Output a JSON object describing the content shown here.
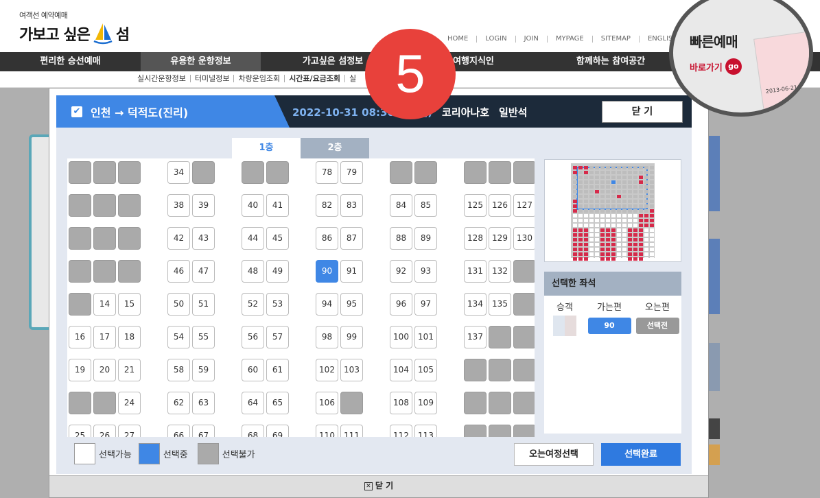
{
  "logo": {
    "small": "여객선 예약예매",
    "big_a": "가보고 싶은",
    "big_b": "섬"
  },
  "util_nav": [
    "HOME",
    "LOGIN",
    "JOIN",
    "MYPAGE",
    "SITEMAP",
    "ENGLISH"
  ],
  "gnb": [
    "편리한 승선예매",
    "유용한 운항정보",
    "가고싶은 섬정보",
    "여행지식인",
    "함께하는 참여공간"
  ],
  "lnb": [
    "실시간운항정보",
    "터미널정보",
    "차량운임조회",
    "시간표/요금조회",
    "실"
  ],
  "quick": {
    "title": "빠른예매",
    "link": "바로가기",
    "go": "go",
    "ticket_date": "2013-06-21"
  },
  "step_badge": "5",
  "modal": {
    "route": "인천 → 덕적도(진리)",
    "datetime": "2022-10-31 08:30(가는편)",
    "ship": "코리아나호",
    "grade": "일반석",
    "close": "닫 기",
    "tabs": [
      "1층",
      "2층"
    ],
    "selected_title": "선택한 좌석",
    "col_passenger": "승객",
    "col_outbound": "가는편",
    "col_return": "오는편",
    "outbound_seat": "90",
    "return_seat": "선택전",
    "legend": {
      "available": "선택가능",
      "selecting": "선택중",
      "unavailable": "선택불가"
    },
    "return_button": "오는여정선택",
    "complete_button": "선택완료",
    "bottom_close": "닫 기"
  },
  "colors": {
    "accent": "#3f87e5",
    "header_dark": "#1c2a3a",
    "unavailable": "#aaaaaa",
    "badge": "#e8413b"
  },
  "seat_rows": [
    [
      [
        "",
        0
      ],
      [
        "",
        0
      ],
      [
        "",
        0
      ],
      null,
      [
        "34",
        1
      ],
      [
        "",
        0
      ],
      null,
      [
        "",
        0
      ],
      [
        "",
        0
      ],
      null,
      [
        "78",
        1
      ],
      [
        "79",
        1
      ],
      null,
      [
        "",
        0
      ],
      [
        "",
        0
      ],
      null,
      [
        "",
        0
      ],
      [
        "",
        0
      ],
      [
        "",
        0
      ]
    ],
    [
      [
        "",
        0
      ],
      [
        "",
        0
      ],
      [
        "",
        0
      ],
      null,
      [
        "38",
        1
      ],
      [
        "39",
        1
      ],
      null,
      [
        "40",
        1
      ],
      [
        "41",
        1
      ],
      null,
      [
        "82",
        1
      ],
      [
        "83",
        1
      ],
      null,
      [
        "84",
        1
      ],
      [
        "85",
        1
      ],
      null,
      [
        "125",
        1
      ],
      [
        "126",
        1
      ],
      [
        "127",
        1
      ]
    ],
    [
      [
        "",
        0
      ],
      [
        "",
        0
      ],
      [
        "",
        0
      ],
      null,
      [
        "42",
        1
      ],
      [
        "43",
        1
      ],
      null,
      [
        "44",
        1
      ],
      [
        "45",
        1
      ],
      null,
      [
        "86",
        1
      ],
      [
        "87",
        1
      ],
      null,
      [
        "88",
        1
      ],
      [
        "89",
        1
      ],
      null,
      [
        "128",
        1
      ],
      [
        "129",
        1
      ],
      [
        "130",
        1
      ]
    ],
    [
      [
        "",
        0
      ],
      [
        "",
        0
      ],
      [
        "",
        0
      ],
      null,
      [
        "46",
        1
      ],
      [
        "47",
        1
      ],
      null,
      [
        "48",
        1
      ],
      [
        "49",
        1
      ],
      null,
      [
        "90",
        2
      ],
      [
        "91",
        1
      ],
      null,
      [
        "92",
        1
      ],
      [
        "93",
        1
      ],
      null,
      [
        "131",
        1
      ],
      [
        "132",
        1
      ],
      [
        "",
        0
      ]
    ],
    [
      [
        "",
        0
      ],
      [
        "14",
        1
      ],
      [
        "15",
        1
      ],
      null,
      [
        "50",
        1
      ],
      [
        "51",
        1
      ],
      null,
      [
        "52",
        1
      ],
      [
        "53",
        1
      ],
      null,
      [
        "94",
        1
      ],
      [
        "95",
        1
      ],
      null,
      [
        "96",
        1
      ],
      [
        "97",
        1
      ],
      null,
      [
        "134",
        1
      ],
      [
        "135",
        1
      ],
      [
        "",
        0
      ]
    ],
    [
      [
        "16",
        1
      ],
      [
        "17",
        1
      ],
      [
        "18",
        1
      ],
      null,
      [
        "54",
        1
      ],
      [
        "55",
        1
      ],
      null,
      [
        "56",
        1
      ],
      [
        "57",
        1
      ],
      null,
      [
        "98",
        1
      ],
      [
        "99",
        1
      ],
      null,
      [
        "100",
        1
      ],
      [
        "101",
        1
      ],
      null,
      [
        "137",
        1
      ],
      [
        "",
        0
      ],
      [
        "",
        0
      ]
    ],
    [
      [
        "19",
        1
      ],
      [
        "20",
        1
      ],
      [
        "21",
        1
      ],
      null,
      [
        "58",
        1
      ],
      [
        "59",
        1
      ],
      null,
      [
        "60",
        1
      ],
      [
        "61",
        1
      ],
      null,
      [
        "102",
        1
      ],
      [
        "103",
        1
      ],
      null,
      [
        "104",
        1
      ],
      [
        "105",
        1
      ],
      null,
      [
        "",
        0
      ],
      [
        "",
        0
      ],
      [
        "",
        0
      ]
    ],
    [
      [
        "",
        0
      ],
      [
        "",
        0
      ],
      [
        "24",
        1
      ],
      null,
      [
        "62",
        1
      ],
      [
        "63",
        1
      ],
      null,
      [
        "64",
        1
      ],
      [
        "65",
        1
      ],
      null,
      [
        "106",
        1
      ],
      [
        "",
        0
      ],
      null,
      [
        "108",
        1
      ],
      [
        "109",
        1
      ],
      null,
      [
        "",
        0
      ],
      [
        "",
        0
      ],
      [
        "",
        0
      ]
    ],
    [
      [
        "25",
        1
      ],
      [
        "26",
        1
      ],
      [
        "27",
        1
      ],
      null,
      [
        "66",
        1
      ],
      [
        "67",
        1
      ],
      null,
      [
        "68",
        1
      ],
      [
        "69",
        1
      ],
      null,
      [
        "110",
        1
      ],
      [
        "111",
        1
      ],
      null,
      [
        "112",
        1
      ],
      [
        "113",
        1
      ],
      null,
      [
        "",
        0
      ],
      [
        "",
        0
      ],
      [
        "",
        0
      ]
    ]
  ]
}
